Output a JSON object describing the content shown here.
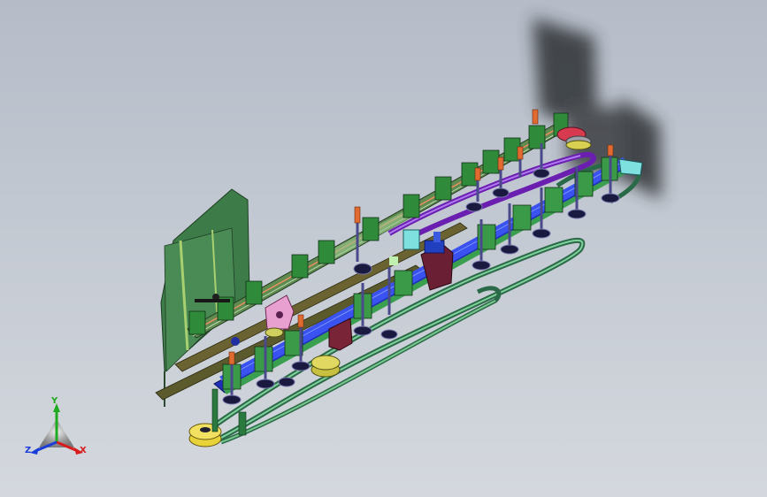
{
  "viewport": {
    "background_top": "#b5bcc8",
    "background_bottom": "#d4d8de"
  },
  "model": {
    "colors": {
      "frame_green": "#3f7a4a",
      "bright_green": "#7fd07a",
      "blue_rail": "#2a3fd8",
      "purple_belt": "#8a35d6",
      "orange_pin": "#e07030",
      "yellow_pulley": "#e8d23a",
      "pink_part": "#e8a0d0",
      "maroon_part": "#7a2438",
      "cyan_part": "#7fe0e0",
      "red_pulley": "#d83a50"
    }
  },
  "triad": {
    "x_label": "X",
    "y_label": "Y",
    "z_label": "Z",
    "x_color": "#d81c1c",
    "y_color": "#1faa1f",
    "z_color": "#1c3ed8"
  }
}
